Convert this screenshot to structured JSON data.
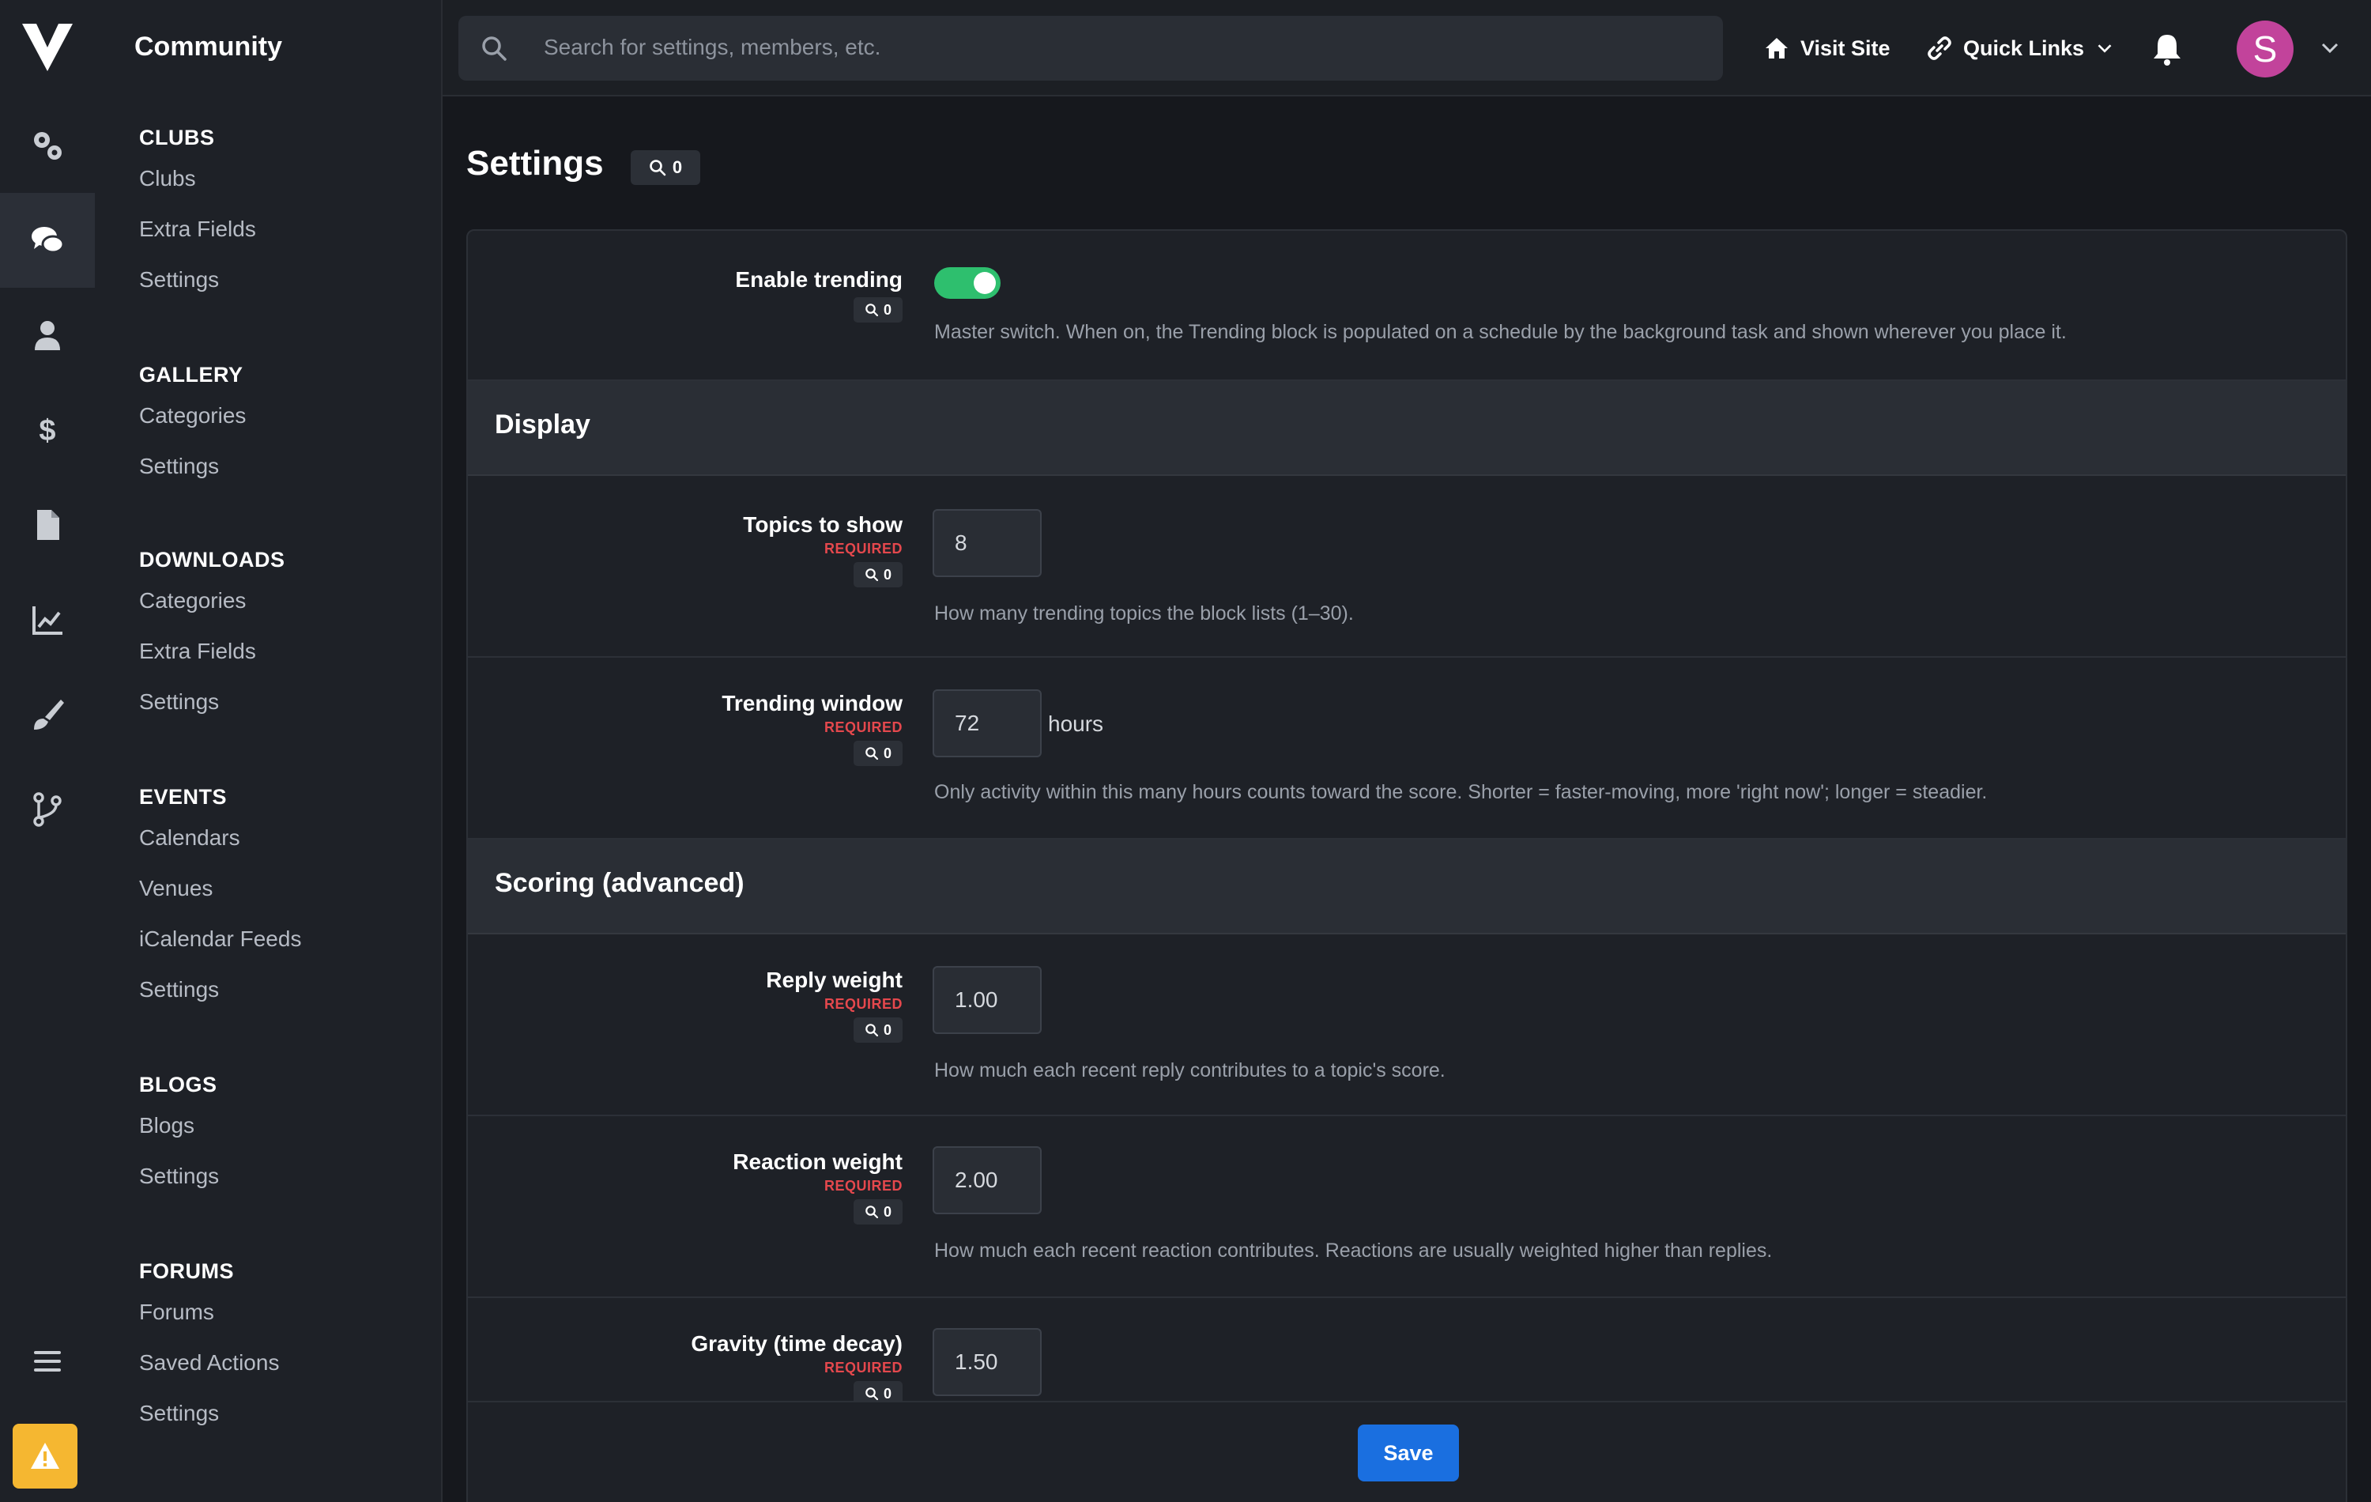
{
  "app": {
    "title": "Community"
  },
  "nav_rail": {
    "items": [
      {
        "icon": "gears-icon"
      },
      {
        "icon": "chat-icon",
        "active": true
      },
      {
        "icon": "user-icon"
      },
      {
        "icon": "dollar-icon"
      },
      {
        "icon": "file-icon"
      },
      {
        "icon": "chart-icon"
      },
      {
        "icon": "brush-icon"
      },
      {
        "icon": "branch-icon"
      }
    ]
  },
  "subnav": {
    "sections": [
      {
        "heading": "CLUBS",
        "items": [
          "Clubs",
          "Extra Fields",
          "Settings"
        ]
      },
      {
        "heading": "GALLERY",
        "items": [
          "Categories",
          "Settings"
        ]
      },
      {
        "heading": "DOWNLOADS",
        "items": [
          "Categories",
          "Extra Fields",
          "Settings"
        ]
      },
      {
        "heading": "EVENTS",
        "items": [
          "Calendars",
          "Venues",
          "iCalendar Feeds",
          "Settings"
        ]
      },
      {
        "heading": "BLOGS",
        "items": [
          "Blogs",
          "Settings"
        ]
      },
      {
        "heading": "FORUMS",
        "items": [
          "Forums",
          "Saved Actions",
          "Settings"
        ]
      }
    ]
  },
  "topbar": {
    "search_placeholder": "Search for settings, members, etc.",
    "visit_site": "Visit Site",
    "quick_links": "Quick Links",
    "avatar_letter": "S"
  },
  "page": {
    "title": "Settings",
    "title_badge": "0"
  },
  "settings": {
    "enable_trending": {
      "label": "Enable trending",
      "badge": "0",
      "enabled": true,
      "help": "Master switch. When on, the Trending block is populated on a schedule by the background task and shown wherever you place it."
    },
    "display_section": "Display",
    "topics_to_show": {
      "label": "Topics to show",
      "required": "REQUIRED",
      "badge": "0",
      "value": "8",
      "help": "How many trending topics the block lists (1–30)."
    },
    "trending_window": {
      "label": "Trending window",
      "required": "REQUIRED",
      "badge": "0",
      "value": "72",
      "unit": "hours",
      "help": "Only activity within this many hours counts toward the score. Shorter = faster-moving, more 'right now'; longer = steadier."
    },
    "scoring_section": "Scoring (advanced)",
    "reply_weight": {
      "label": "Reply weight",
      "required": "REQUIRED",
      "badge": "0",
      "value": "1.00",
      "help": "How much each recent reply contributes to a topic's score."
    },
    "reaction_weight": {
      "label": "Reaction weight",
      "required": "REQUIRED",
      "badge": "0",
      "value": "2.00",
      "help": "How much each recent reaction contributes. Reactions are usually weighted higher than replies."
    },
    "gravity": {
      "label": "Gravity (time decay)",
      "required": "REQUIRED",
      "badge": "0",
      "value": "1.50"
    }
  },
  "save_label": "Save",
  "colors": {
    "accent": "#1a6fe0",
    "toggle_on": "#2ebf6e",
    "required": "#e5484d",
    "warning": "#f5b731",
    "avatar": "#c2439b"
  }
}
